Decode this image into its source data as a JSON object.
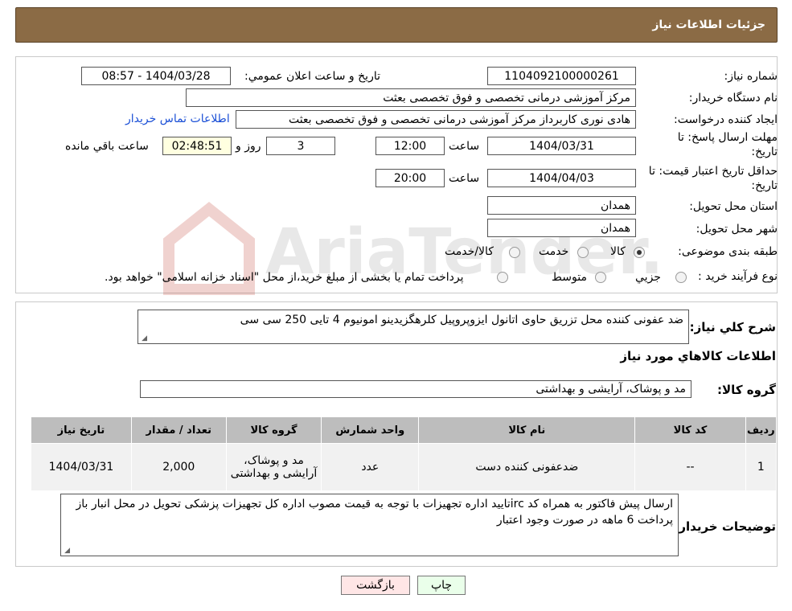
{
  "header": {
    "title": "جزئیات اطلاعات نیاز"
  },
  "watermark": {
    "text": "AriaTender.neT"
  },
  "form": {
    "need_number_label": "شماره نیاز:",
    "need_number": "1104092100000261",
    "announce_label": "تاریخ و ساعت اعلان عمومي:",
    "announce_value": "1404/03/28 - 08:57",
    "buyer_org_label": "نام دستگاه خريدار:",
    "buyer_org": "مرکز آموزشی درمانی تخصصی و فوق تخصصی بعثت",
    "creator_label": "ايجاد کننده درخواست:",
    "creator": "هادی نوری کاربرداز مرکز آموزشی درمانی تخصصی و فوق تخصصی بعثت",
    "contact_link": "اطلاعات تماس خريدار",
    "deadline_label_line1": "مهلت ارسال پاسخ: تا",
    "deadline_label_line2": "تاريخ:",
    "deadline_date": "1404/03/31",
    "time_label": "ساعت",
    "deadline_time": "12:00",
    "days_value": "3",
    "days_label": "روز و",
    "remaining_time": "02:48:51",
    "remaining_label": "ساعت باقي مانده",
    "validity_label_line1": "حداقل تاريخ اعتبار قيمت: تا",
    "validity_label_line2": "تاريخ:",
    "validity_date": "1404/04/03",
    "validity_time": "20:00",
    "province_label": "استان محل تحويل:",
    "province": "همدان",
    "city_label": "شهر محل تحويل:",
    "city": "همدان",
    "category_label": "طبقه بندی موضوعی:",
    "category_options": [
      "كالا",
      "خدمت",
      "كالا/خدمت"
    ],
    "category_selected": "كالا",
    "process_label": "نوع فرآيند خريد :",
    "process_options": [
      "جزیي",
      "متوسط"
    ],
    "process_note": "پرداخت تمام یا بخشی از مبلغ خرید،از محل \"اسناد خزانه اسلامی\" خواهد بود."
  },
  "description": {
    "summary_label": "شرح كلي نياز:",
    "summary": "ضد عفونی کننده محل تزریق حاوی اتانول ایزوپروپیل کلرهگزیدینو امونیوم 4 تایی 250 سی سی",
    "goods_info_title": "اطلاعات كالاهاي مورد نياز",
    "goods_group_label": "گروه كالا:",
    "goods_group": "مد و پوشاک، آرایشی و بهداشتی"
  },
  "table": {
    "headers": [
      "رديف",
      "كد كالا",
      "نام كالا",
      "واحد شمارش",
      "گروه كالا",
      "تعداد / مقدار",
      "تاريخ نياز"
    ],
    "rows": [
      {
        "row": "1",
        "code": "--",
        "name": "ضدعفونی کننده دست",
        "unit": "عدد",
        "group": "مد و پوشاک، آرایشی و بهداشتی",
        "qty": "2,000",
        "date": "1404/03/31"
      }
    ]
  },
  "buyer_notes": {
    "label": "توضيحات خريدار:",
    "text": "ارسال پیش فاکتور به همراه کد ircتایید اداره تجهیزات  با توجه به قیمت مصوب اداره کل تجهیزات پزشکی تحویل در محل انبار باز پرداخت 6 ماهه در صورت وجود اعتبار"
  },
  "buttons": {
    "print": "چاپ",
    "back": "بازگشت"
  }
}
